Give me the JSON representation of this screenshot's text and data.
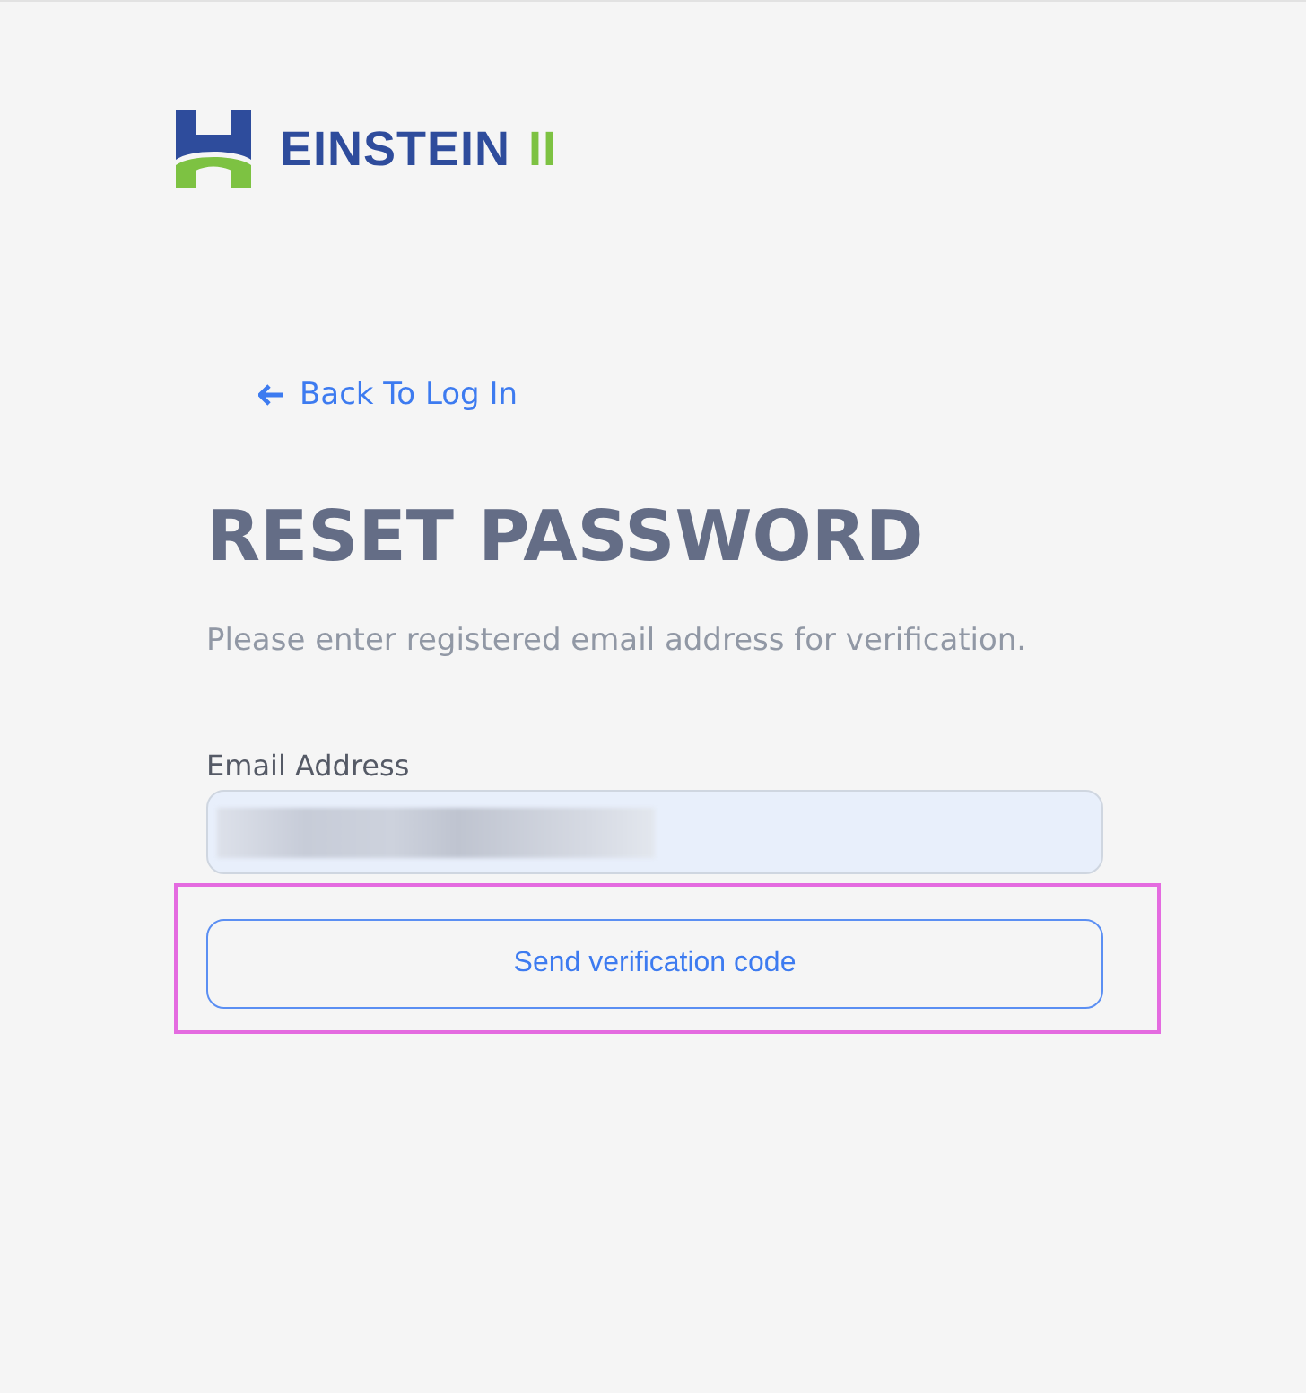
{
  "logo": {
    "name": "EINSTEIN",
    "suffix": "II"
  },
  "back_link": {
    "label": "Back To Log In"
  },
  "title": "RESET PASSWORD",
  "subtitle": "Please enter registered email address for verification.",
  "email_field": {
    "label": "Email Address",
    "redacted": true
  },
  "submit_button": {
    "label": "Send verification code",
    "highlighted": true
  }
}
